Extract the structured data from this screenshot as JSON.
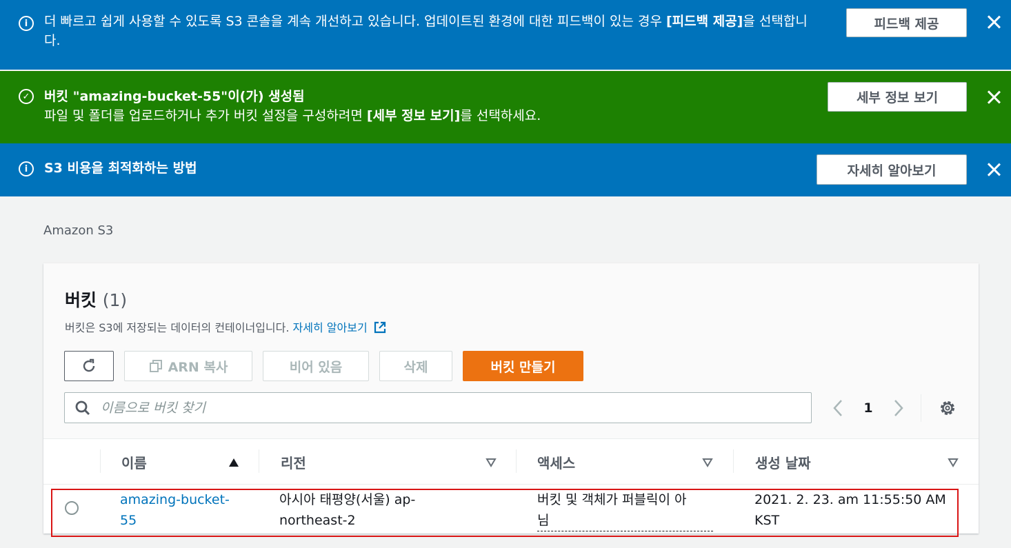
{
  "flashbars": {
    "feedback": {
      "icon": "info-icon",
      "text_plain": "더 빠르고 쉽게 사용할 수 있도록 S3 콘솔을 계속 개선하고 있습니다. 업데이트된 환경에 대한 피드백이 있는 경우 ",
      "text_bold": "[피드백 제공]",
      "text_end": "을 선택합니다.",
      "button": "피드백 제공"
    },
    "created": {
      "icon": "check-circle-icon",
      "title": "버킷 \"amazing-bucket-55\"이(가) 생성됨",
      "text_plain": "파일 및 폴더를 업로드하거나 추가 버킷 설정을 구성하려면 ",
      "text_bold": "[세부 정보 보기]",
      "text_end": "를 선택하세요.",
      "button": "세부 정보 보기"
    },
    "cost": {
      "icon": "info-icon",
      "title": "S3 비용을 최적화하는 방법",
      "button": "자세히 알아보기"
    }
  },
  "breadcrumb": "Amazon S3",
  "panel": {
    "title": "버킷",
    "count": "(1)",
    "description": "버킷은 S3에 저장되는 데이터의 컨테이너입니다. ",
    "learn_more": "자세히 알아보기"
  },
  "actions": {
    "copy_arn": "ARN 복사",
    "empty": "비어 있음",
    "delete": "삭제",
    "create": "버킷 만들기"
  },
  "search": {
    "placeholder": "이름으로 버킷 찾기"
  },
  "pagination": {
    "current": "1"
  },
  "table": {
    "columns": [
      "이름",
      "리전",
      "액세스",
      "생성 날짜"
    ],
    "rows": [
      {
        "name_line1": "amazing-bucket-",
        "name_line2": "55",
        "region_line1": "아시아 태평양(서울) ap-",
        "region_line2": "northeast-2",
        "access_line1": "버킷 및 객체가 퍼블릭이 아",
        "access_line2": "님",
        "created_line1": "2021. 2. 23. am 11:55:50 AM",
        "created_line2": "KST"
      }
    ]
  },
  "colors": {
    "info_blue": "#0073bb",
    "success_green": "#1d8102",
    "primary_orange": "#ec7211",
    "highlight_red": "#d91515"
  }
}
